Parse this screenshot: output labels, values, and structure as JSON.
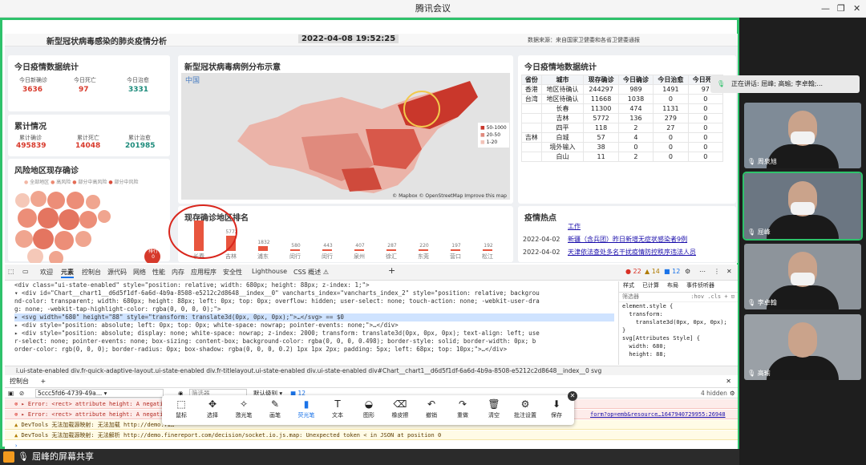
{
  "window": {
    "title": "腾讯会议"
  },
  "dashboard": {
    "title": "新型冠状病毒感染的肺炎疫情分析",
    "datetime": "2022-04-08 19:52:25",
    "source": "数据来源：来自国家卫健委和各省卫健委通报",
    "today": {
      "title": "今日疫情数据统计",
      "l1": "今日新确诊",
      "l2": "今日死亡",
      "l3": "今日治愈",
      "v1": "3636",
      "v2": "97",
      "v3": "3331"
    },
    "cumulative": {
      "title": "累计情况",
      "l1": "累计确诊",
      "l2": "累计死亡",
      "l3": "累计治愈",
      "v1": "495839",
      "v2": "14048",
      "v3": "201985"
    },
    "risk": {
      "title": "风险地区现存确诊",
      "legend": [
        "全部地区",
        "高风险",
        "部分中高风险",
        "部分中风险"
      ],
      "badge": "排行",
      "badge_v": "0"
    },
    "map": {
      "title": "新型冠状病毒病例分布示意",
      "tab": "中国",
      "legend": [
        "50-1000",
        "20-50",
        "1-20"
      ],
      "credit": "© Mapbox © OpenStreetMap Improve this map"
    },
    "ranking": {
      "title": "现存确诊地区排名",
      "items": [
        {
          "name": "长春",
          "value": "11300"
        },
        {
          "name": "吉林",
          "value": "5772"
        },
        {
          "name": "浦东",
          "value": "1832"
        },
        {
          "name": "闵行",
          "value": "580"
        },
        {
          "name": "闵行",
          "value": "443"
        },
        {
          "name": "泉州",
          "value": "407"
        },
        {
          "name": "徐汇",
          "value": "287"
        },
        {
          "name": "东莞",
          "value": "220"
        },
        {
          "name": "营口",
          "value": "197"
        },
        {
          "name": "松江",
          "value": "192"
        }
      ]
    },
    "province_table": {
      "title": "今日疫情地数据统计",
      "headers": [
        "省份",
        "城市",
        "现存确诊",
        "今日确诊",
        "今日治愈",
        "今日死亡"
      ],
      "rows": [
        [
          "香港",
          "地区待确认",
          "244297",
          "989",
          "1491",
          "97"
        ],
        [
          "台湾",
          "地区待确认",
          "11668",
          "1038",
          "0",
          "0"
        ],
        [
          "",
          "长春",
          "11300",
          "474",
          "1131",
          "0"
        ],
        [
          "",
          "吉林",
          "5772",
          "136",
          "279",
          "0"
        ],
        [
          "",
          "四平",
          "118",
          "2",
          "27",
          "0"
        ],
        [
          "吉林",
          "白城",
          "57",
          "4",
          "0",
          "0"
        ],
        [
          "",
          "境外输入",
          "38",
          "0",
          "0",
          "0"
        ],
        [
          "",
          "白山",
          "11",
          "2",
          "0",
          "0"
        ]
      ]
    },
    "hot": {
      "title": "疫情热点",
      "items": [
        {
          "date": "",
          "text": "工作"
        },
        {
          "date": "2022-04-02",
          "text": "新疆（含兵团）昨日新增无症状感染者9例"
        },
        {
          "date": "2022-04-02",
          "text": "天津依法查处多名干扰疫情防控秩序违法人员"
        }
      ]
    }
  },
  "devtools": {
    "tabs": [
      "欢迎",
      "元素",
      "控制台",
      "源代码",
      "网络",
      "性能",
      "内存",
      "应用程序",
      "安全性",
      "Lighthouse",
      "CSS 概述 ⚠"
    ],
    "counts": {
      "errors": "22",
      "warnings": "14",
      "info": "12"
    },
    "elements": [
      "<div class=\"ui-state-enabled\" style=\"position: relative; width: 680px; height: 88px; z-index: 1;\">",
      "▾ <div id=\"Chart__chart1__d6d5f1df-6a6d-4b9a-8508-e5212c2d8648__index__0\" vancharts_index=\"vancharts_index_2\" style=\"position: relative; backgrou",
      "nd-color: transparent; width: 680px; height: 88px; left: 0px; top: 0px; overflow: hidden; user-select: none; touch-action: none; -webkit-user-dra",
      "g: none; -webkit-tap-highlight-color: rgba(0, 0, 0, 0);\">",
      "  ▸ <svg width=\"680\" height=\"88\" style=\"transform: translate3d(0px, 0px, 0px);\">…</svg> == $0",
      "  ▸ <div style=\"position: absolute; left: 0px; top: 0px; white-space: nowrap; pointer-events: none;\">…</div>",
      "  ▸ <div style=\"position: absolute; display: none; white-space: nowrap; z-index: 2000; transform: translate3d(0px, 0px, 0px); text-align: left; use",
      "r-select: none; pointer-events: none; box-sizing: content-box; background-color: rgba(0, 0, 0, 0.498); border-style: solid; border-width: 0px; b",
      "order-color: rgb(0, 0, 0); border-radius: 0px; box-shadow: rgba(0, 0, 0, 0.2) 1px 1px 2px; padding: 5px; left: 68px; top: 10px;\">…</div>"
    ],
    "styles_tabs": [
      "样式",
      "已计算",
      "布局",
      "事件侦听器"
    ],
    "filter": "筛选器",
    "styles": [
      "element.style {",
      "  transform:",
      "    translate3d(0px, 0px, 0px);",
      "}",
      "svg[Attributes Style] {",
      "  width: 680;",
      "  height: 88;"
    ],
    "breadcrumbs": "i.ui-state-enabled   div.fr-quick-adaptive-layout.ui-state-enabled   div.fr-titlelayout.ui-state-enabled   div.ui-state-enabled   div#Chart__chart1__d6d5f1df-6a6d-4b9a-8508-e5212c2d8648__index__0   svg",
    "console": {
      "tab": "控制台",
      "context": "5ccc5fd6-4739-49a…",
      "filter": "筛选器",
      "level": "默认级别 ▾",
      "issues": "12",
      "hidden": "4 hidden",
      "lines": [
        "▸ Error: <rect> attribute height: A negative value is not valid. (\"-4.863899432376013\")",
        "▸ Error: <rect> attribute height: A negative value is not valid. (\"-4.86389…",
        "  DevTools 无法加载源映射: 无法加载 http://demo.fi…",
        "  DevTools 无法加载源映射: 无法解析 http://demo.finereport.com/decision/socket.io.js.map: Unexpected token < in JSON at position 0"
      ],
      "link": "form?op=emb&resource…1647940729955:26948"
    }
  },
  "annotation_toolbar": {
    "tools": [
      "鼠标",
      "选择",
      "激光笔",
      "画笔",
      "荧光笔",
      "文本",
      "图形",
      "橡皮擦",
      "撤销",
      "重做",
      "清空",
      "批注设置",
      "保存"
    ]
  },
  "meeting": {
    "speaking": "正在讲话: 屈峰; 高瑜; 李卓翰;...",
    "participants": [
      "周泉旭",
      "屈峰",
      "李卓翰",
      "高瑜"
    ],
    "share_label": "屈峰的屏幕共享"
  }
}
